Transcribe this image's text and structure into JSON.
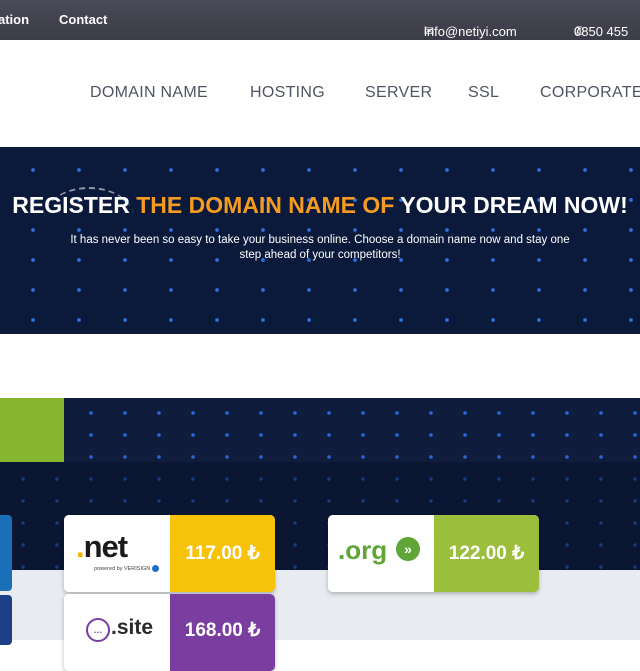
{
  "topbar": {
    "left_link_partial": "ation",
    "contact": "Contact",
    "email": "info@netiyi.com",
    "phone": "0850 455",
    "email_icon": "envelope-icon",
    "phone_icon": "phone-icon"
  },
  "nav": {
    "items": [
      "DOMAIN NAME",
      "HOSTING",
      "SERVER",
      "SSL",
      "CORPORATE"
    ]
  },
  "hero": {
    "title_part1": "REGISTER ",
    "title_highlight": "THE DOMAIN NAME OF",
    "title_part2": " YOUR DREAM NOW!",
    "subtitle": "It has never been so easy to take your business online. Choose a domain name now and stay one step ahead of your competitors!",
    "highlight_color": "#f59b1f"
  },
  "domains": [
    {
      "ext": ".net",
      "tagline": "powered by VERISIGN",
      "price": "117.00 ₺",
      "color": "#f6c20a"
    },
    {
      "ext": ".org",
      "price": "122.00 ₺",
      "color": "#9bbf3c"
    },
    {
      "ext": ".site",
      "price": "168.00 ₺",
      "color": "#7a3da0"
    }
  ],
  "colors": {
    "topbar": "#45454f",
    "hero_bg": "#0b1a3a",
    "accent_green": "#86b72f"
  }
}
